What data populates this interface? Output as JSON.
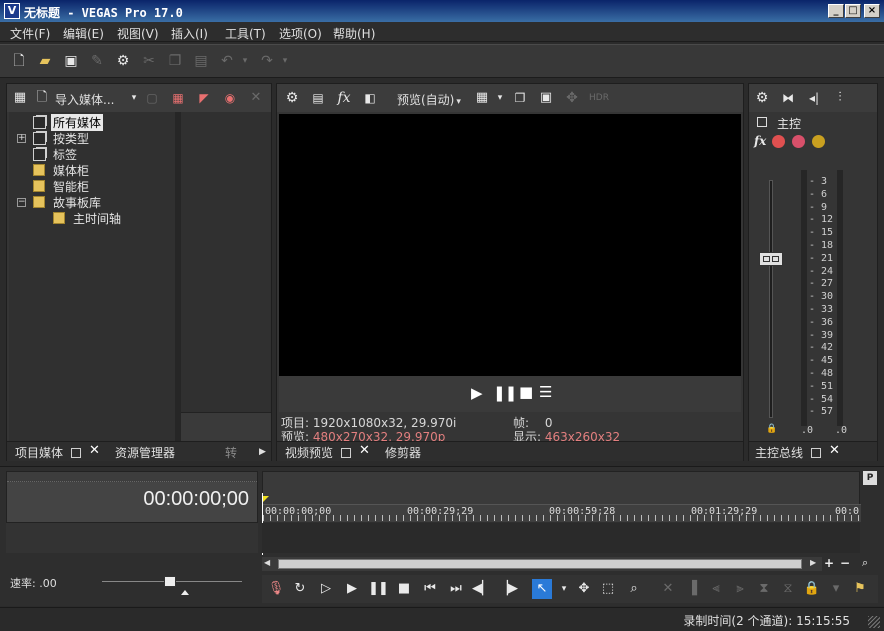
{
  "window": {
    "title": "无标题 - VEGAS Pro 17.0",
    "icon_letter": "V",
    "controls": [
      "_",
      "□",
      "×"
    ]
  },
  "menu": [
    "文件(F)",
    "编辑(E)",
    "视图(V)",
    "插入(I)",
    "工具(T)",
    "选项(O)",
    "帮助(H)"
  ],
  "media_panel": {
    "import_label": "导入媒体...",
    "tree": [
      {
        "label": "所有媒体",
        "selected": true
      },
      {
        "label": "按类型",
        "expandable": true
      },
      {
        "label": "标签"
      },
      {
        "label": "媒体柜"
      },
      {
        "label": "智能柜"
      },
      {
        "label": "故事板库",
        "expanded": true
      },
      {
        "label": "主时间轴",
        "child": true
      }
    ],
    "tabs": [
      "项目媒体",
      "资源管理器",
      "转"
    ]
  },
  "preview_panel": {
    "preview_mode": "预览(自动)",
    "project_label": "项目:",
    "project_value": "1920x1080x32, 29.970i",
    "preview_label": "预览:",
    "preview_value": "480x270x32, 29.970p",
    "frame_label": "帧:",
    "frame_value": "0",
    "display_label": "显示:",
    "display_value": "463x260x32",
    "tabs": [
      "视频预览",
      "修剪器"
    ],
    "value_color": "#e37f7f"
  },
  "master_panel": {
    "title": "主控",
    "ticks": [
      "3",
      "6",
      "9",
      "12",
      "15",
      "18",
      "21",
      "24",
      "27",
      "30",
      "33",
      "36",
      "39",
      "42",
      "45",
      "48",
      "51",
      "54",
      "57"
    ],
    "bottom_left": ".0",
    "bottom_right": ".0",
    "tab": "主控总线"
  },
  "timeline": {
    "timecode": "00:00:00;00",
    "ruler": [
      "00:00:00;00",
      "00:00:29;29",
      "00:00:59;28",
      "00:01:29;29",
      "00:0"
    ],
    "rate_label": "速率: .00",
    "marker_icon": "P"
  },
  "status": {
    "record_time": "录制时间(2 个通道): 15:15:55"
  }
}
